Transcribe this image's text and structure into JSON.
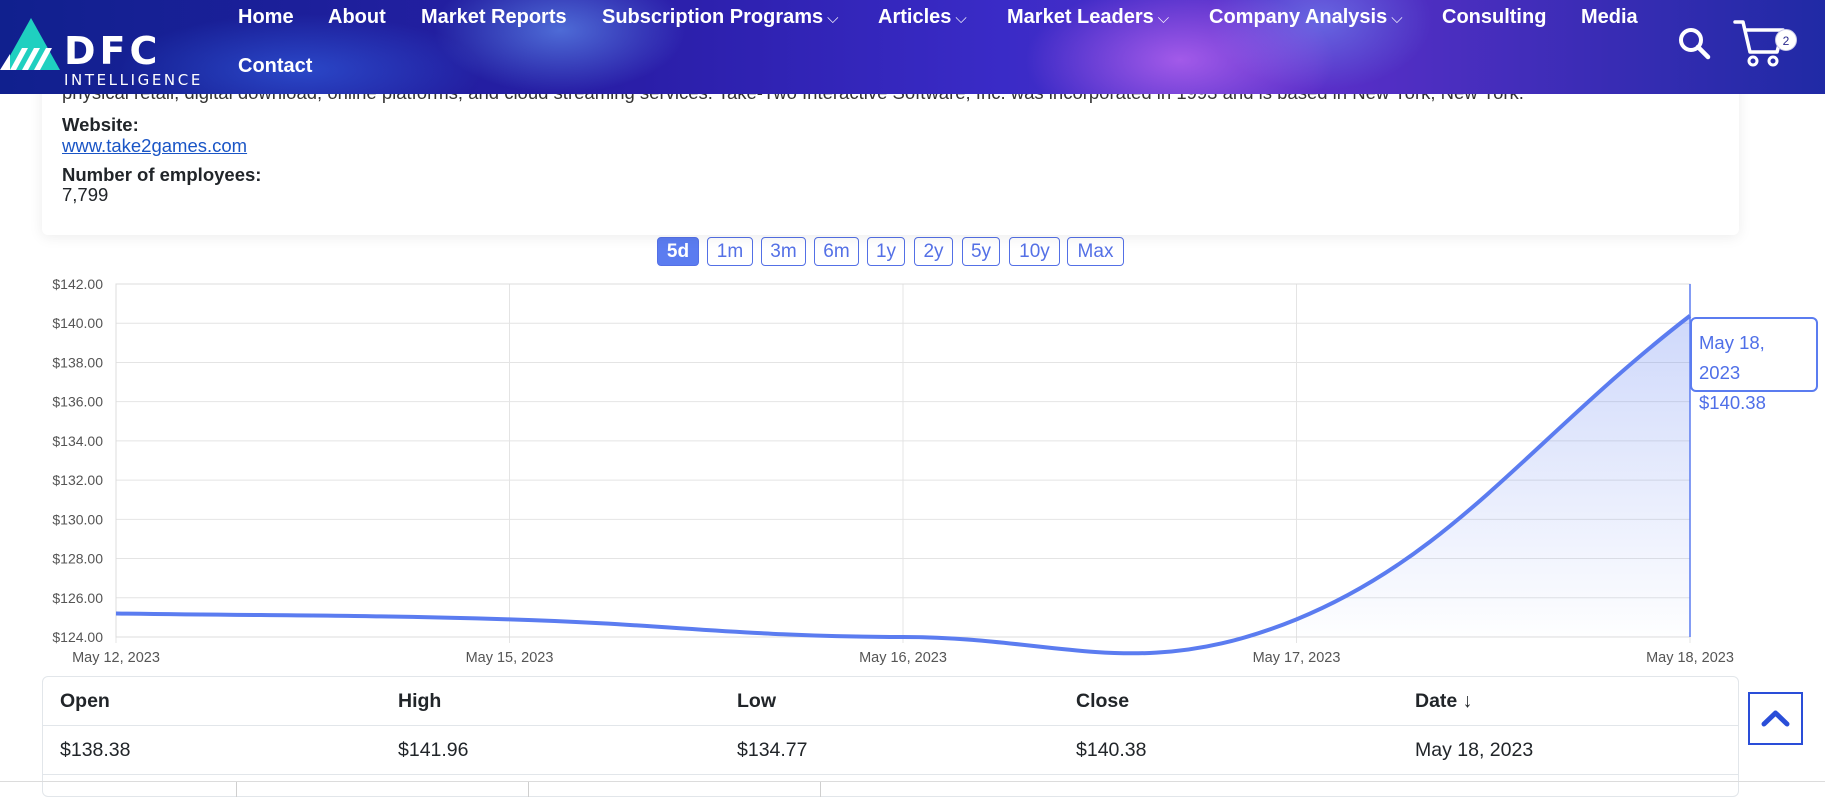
{
  "header": {
    "logo_text": "DFC",
    "logo_subtext": "INTELLIGENCE",
    "nav": [
      {
        "label": "Home",
        "has_dropdown": false
      },
      {
        "label": "About",
        "has_dropdown": false
      },
      {
        "label": "Market Reports",
        "has_dropdown": false
      },
      {
        "label": "Subscription Programs",
        "has_dropdown": true
      },
      {
        "label": "Articles",
        "has_dropdown": true
      },
      {
        "label": "Market Leaders",
        "has_dropdown": true
      },
      {
        "label": "Company Analysis",
        "has_dropdown": true
      },
      {
        "label": "Consulting",
        "has_dropdown": false
      },
      {
        "label": "Media",
        "has_dropdown": false
      },
      {
        "label": "Contact",
        "has_dropdown": false
      }
    ],
    "dropdown_glyph": "⌵",
    "icons": [
      "search-icon",
      "cart-icon"
    ],
    "cart_count": "2"
  },
  "company": {
    "description_partial": "physical retail, digital download, online platforms, and cloud streaming services. Take-Two Interactive Software, Inc. was incorporated in 1993 and is based in New York, New York.",
    "website_label": "Website:",
    "website_value": "www.take2games.com",
    "employees_label": "Number of employees:",
    "employees_value": "7,799"
  },
  "range_buttons": {
    "options": [
      "5d",
      "1m",
      "3m",
      "6m",
      "1y",
      "2y",
      "5y",
      "10y",
      "Max"
    ],
    "active": "5d"
  },
  "chart_data": {
    "type": "area",
    "x": [
      "May 12, 2023",
      "May 15, 2023",
      "May 16, 2023",
      "May 17, 2023",
      "May 18, 2023"
    ],
    "values": [
      125.2,
      124.9,
      124.0,
      124.9,
      140.38
    ],
    "ylim": [
      124,
      142
    ],
    "y_ticks": [
      "$124.00",
      "$126.00",
      "$128.00",
      "$130.00",
      "$132.00",
      "$134.00",
      "$136.00",
      "$138.00",
      "$140.00",
      "$142.00"
    ],
    "grid": true,
    "color": "#5b7cf0",
    "tooltip": {
      "date": "May 18, 2023",
      "value": "$140.38"
    }
  },
  "table": {
    "headers": [
      "Open",
      "High",
      "Low",
      "Close",
      "Date ↓"
    ],
    "rows": [
      [
        "$138.38",
        "$141.96",
        "$134.77",
        "$140.38",
        "May 18, 2023"
      ]
    ]
  },
  "scroll_top_icon": "chevron-up-icon"
}
